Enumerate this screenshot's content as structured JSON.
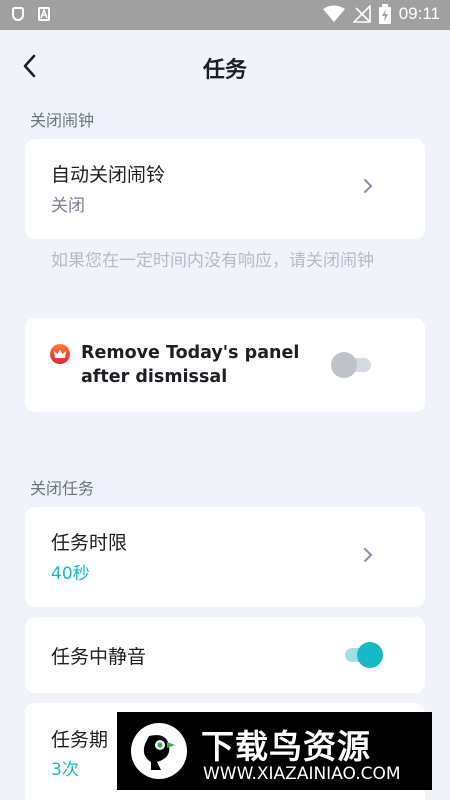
{
  "status_bar": {
    "time": "09:11",
    "icons": [
      "shield-icon",
      "a-notification-icon",
      "wifi-icon",
      "no-signal-icon",
      "battery-charging-icon"
    ]
  },
  "header": {
    "title": "任务",
    "back_icon": "chevron-left-icon"
  },
  "dismiss_alarm_section": {
    "label": "关闭闹钟",
    "auto_dismiss": {
      "label": "自动关闭闹铃",
      "value": "关闭"
    },
    "hint": "如果您在一定时间内没有响应，请关闭闹钟",
    "remove_panel": {
      "label_line1": "Remove Today's panel",
      "label_line2": "after dismissal",
      "enabled": false,
      "premium_icon": "crown-icon"
    }
  },
  "dismiss_task_section": {
    "label": "关闭任务",
    "time_limit": {
      "label": "任务时限",
      "value": "40秒"
    },
    "mute_during_task": {
      "label": "任务中静音",
      "enabled": true
    },
    "task_period": {
      "label": "任务期",
      "value": "3次"
    }
  },
  "watermark": {
    "main_text": "下载鸟资源",
    "url": "WWW.XIAZAINIAO.COM"
  },
  "colors": {
    "accent": "#18b9c5",
    "background": "#f0f4fa",
    "status_bar": "#a0a0a0"
  }
}
